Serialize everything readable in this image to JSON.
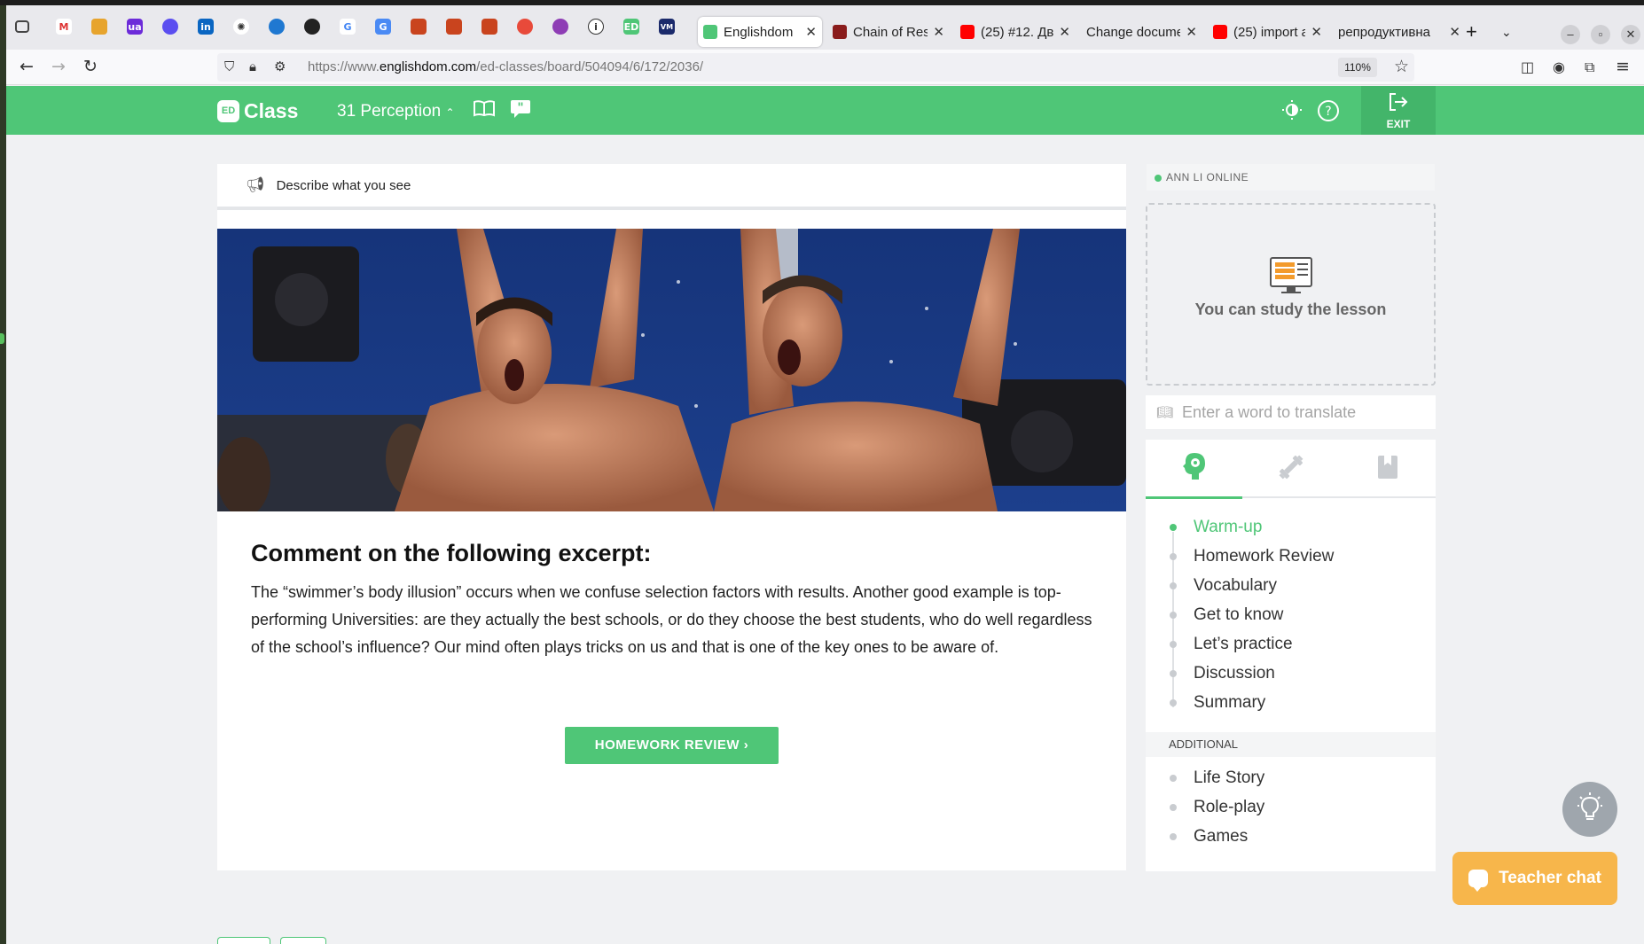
{
  "browser": {
    "tabs": [
      {
        "label": "Englishdom",
        "active": true,
        "favicon_color": "#4fc677"
      },
      {
        "label": "Chain of Res",
        "active": false,
        "favicon_color": "#8a1c1c"
      },
      {
        "label": "(25) #12. Дв",
        "active": false,
        "favicon_color": "#ff0000"
      },
      {
        "label": "Change docume",
        "active": false,
        "favicon_color": ""
      },
      {
        "label": "(25) import a",
        "active": false,
        "favicon_color": "#ff0000"
      },
      {
        "label": "репродуктивна",
        "active": false,
        "favicon_color": ""
      }
    ],
    "new_tab": "+",
    "url_prefix": "https://www.",
    "url_host": "englishdom.com",
    "url_path": "/ed-classes/board/504094/6/172/2036/",
    "zoom": "110%"
  },
  "header": {
    "logo_badge": "ED",
    "logo_text": "Class",
    "lesson": "31 Perception",
    "exit_label": "EXIT",
    "brand_color": "#4fc677"
  },
  "card": {
    "task": "Describe what you see",
    "excerpt_title": "Comment on the following excerpt:",
    "excerpt_text": "The “swimmer’s body illusion” occurs when we confuse selection factors with results. Another good example is top-performing Universities: are they actually the best schools, or do they choose the best students, who do well regardless of the school’s influence? Our mind often plays tricks on us and that is one of the key ones to be aware of.",
    "next_button": "HOMEWORK REVIEW ›"
  },
  "sidebar": {
    "status": "ANN LI ONLINE",
    "study_text": "You can study the lesson",
    "translate_placeholder": "Enter a word to translate",
    "panel_tabs": [
      "lesson-plan-icon",
      "exercises-icon",
      "bookmark-icon"
    ],
    "steps": [
      {
        "label": "Warm-up",
        "active": true
      },
      {
        "label": "Homework Review",
        "active": false
      },
      {
        "label": "Vocabulary",
        "active": false
      },
      {
        "label": "Get to know",
        "active": false
      },
      {
        "label": "Let’s practice",
        "active": false
      },
      {
        "label": "Discussion",
        "active": false
      },
      {
        "label": "Summary",
        "active": false
      }
    ],
    "additional_label": "ADDITIONAL",
    "additional": [
      {
        "label": "Life Story"
      },
      {
        "label": "Role-play"
      },
      {
        "label": "Games"
      }
    ]
  },
  "floating": {
    "teacher_chat": "Teacher chat",
    "chat_color": "#f7b64b"
  }
}
